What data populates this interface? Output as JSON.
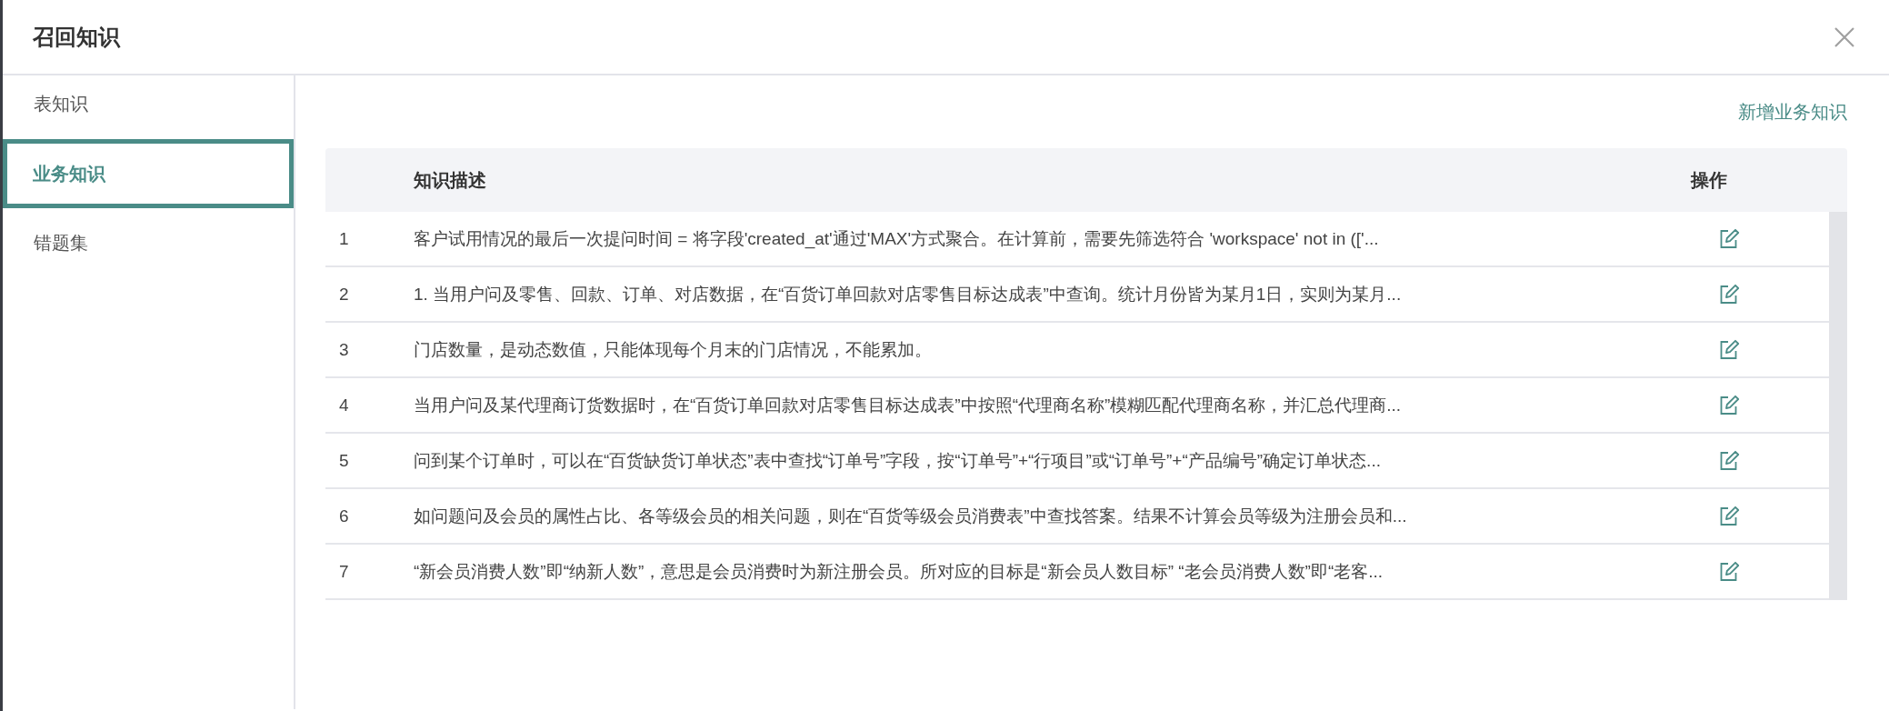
{
  "dialog": {
    "title": "召回知识"
  },
  "sidebar": {
    "items": [
      {
        "label": "表知识",
        "selected": false
      },
      {
        "label": "业务知识",
        "selected": true
      },
      {
        "label": "错题集",
        "selected": false
      }
    ]
  },
  "add_link": "新增业务知识",
  "table": {
    "columns": [
      {
        "label": "知识描述"
      },
      {
        "label": "操作"
      }
    ],
    "rows": [
      {
        "index": "1",
        "description": "客户试用情况的最后一次提问时间 = 将字段'created_at'通过'MAX'方式聚合。在计算前，需要先筛选符合 'workspace' not in (['..."
      },
      {
        "index": "2",
        "description": "1. 当用户问及零售、回款、订单、对店数据，在“百货订单回款对店零售目标达成表”中查询。统计月份皆为某月1日，实则为某月..."
      },
      {
        "index": "3",
        "description": "门店数量，是动态数值，只能体现每个月末的门店情况，不能累加。"
      },
      {
        "index": "4",
        "description": "当用户问及某代理商订货数据时，在“百货订单回款对店零售目标达成表”中按照“代理商名称”模糊匹配代理商名称，并汇总代理商..."
      },
      {
        "index": "5",
        "description": "问到某个订单时，可以在“百货缺货订单状态”表中查找“订单号”字段，按“订单号”+“行项目”或“订单号”+“产品编号”确定订单状态..."
      },
      {
        "index": "6",
        "description": "如问题问及会员的属性占比、各等级会员的相关问题，则在“百货等级会员消费表”中查找答案。结果不计算会员等级为注册会员和..."
      },
      {
        "index": "7",
        "description": "“新会员消费人数”即“纳新人数”，意思是会员消费时为新注册会员。所对应的目标是“新会员人数目标” “老会员消费人数”即“老客..."
      }
    ]
  }
}
